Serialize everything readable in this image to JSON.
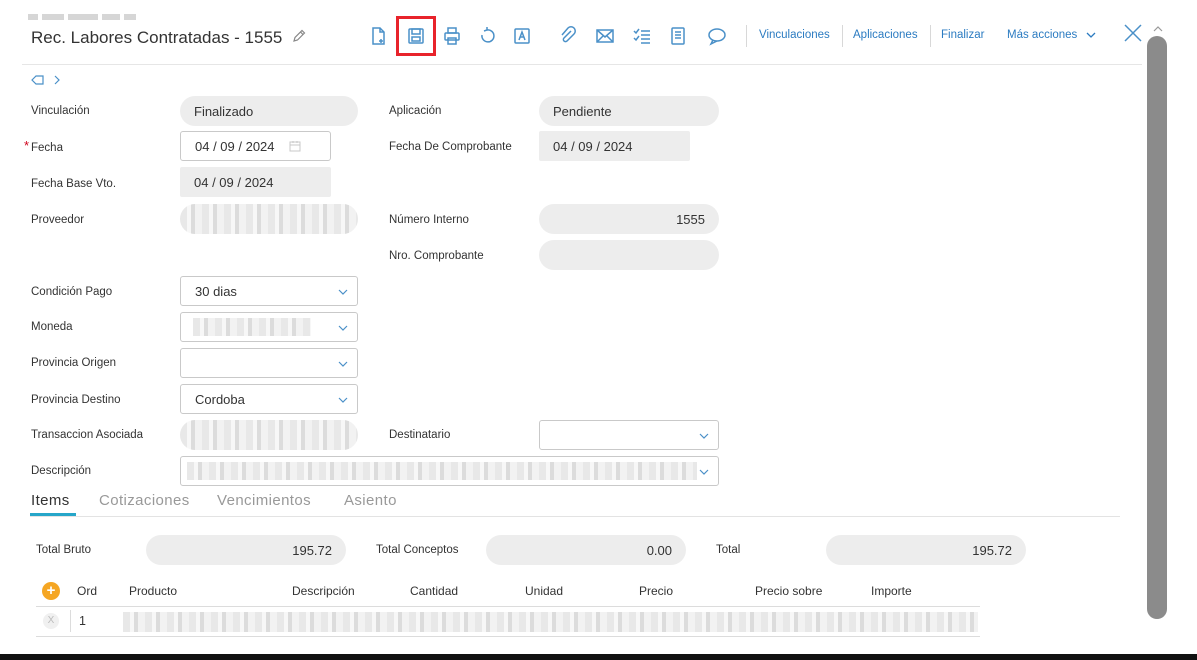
{
  "header": {
    "title": "Rec. Labores Contratadas - 1555",
    "toolbar_links": {
      "vinculaciones": "Vinculaciones",
      "aplicaciones": "Aplicaciones",
      "finalizar": "Finalizar",
      "mas_acciones": "Más acciones"
    },
    "toolbar_icons": [
      "new-document-icon",
      "save-icon",
      "print-icon",
      "undo-icon",
      "font-icon",
      "attach-icon",
      "mail-icon",
      "checklist-icon",
      "report-icon",
      "comment-icon"
    ],
    "highlight_color": "#e8232b",
    "accent_color": "#2b7bc1"
  },
  "form": {
    "vinculacion": {
      "label": "Vinculación",
      "value": "Finalizado"
    },
    "aplicacion": {
      "label": "Aplicación",
      "value": "Pendiente"
    },
    "fecha": {
      "label": "Fecha",
      "required_mark": "*",
      "value": "04 / 09 / 2024"
    },
    "fecha_comprobante": {
      "label": "Fecha De Comprobante",
      "value": "04 / 09 / 2024"
    },
    "fecha_base_vto": {
      "label": "Fecha Base Vto.",
      "value": "04 / 09 / 2024"
    },
    "proveedor": {
      "label": "Proveedor"
    },
    "numero_interno": {
      "label": "Número Interno",
      "value": "1555"
    },
    "nro_comprobante": {
      "label": "Nro. Comprobante",
      "value": ""
    },
    "condicion_pago": {
      "label": "Condición Pago",
      "value": "30 dias"
    },
    "moneda": {
      "label": "Moneda"
    },
    "provincia_origen": {
      "label": "Provincia Origen",
      "value": ""
    },
    "provincia_destino": {
      "label": "Provincia Destino",
      "value": "Cordoba"
    },
    "transaccion_asociada": {
      "label": "Transaccion Asociada"
    },
    "destinatario": {
      "label": "Destinatario",
      "value": ""
    },
    "descripcion": {
      "label": "Descripción"
    }
  },
  "tabs": [
    {
      "label": "Items",
      "active": true
    },
    {
      "label": "Cotizaciones",
      "active": false
    },
    {
      "label": "Vencimientos",
      "active": false
    },
    {
      "label": "Asiento",
      "active": false
    }
  ],
  "totals": {
    "total_bruto": {
      "label": "Total Bruto",
      "value": "195.72"
    },
    "total_conceptos": {
      "label": "Total Conceptos",
      "value": "0.00"
    },
    "total": {
      "label": "Total",
      "value": "195.72"
    }
  },
  "table": {
    "add_label": "+",
    "columns": [
      "Ord",
      "Producto",
      "Descripción",
      "Cantidad",
      "Unidad",
      "Precio",
      "Precio sobre",
      "Importe"
    ],
    "rows": [
      {
        "delete_label": "X",
        "ord": "1"
      }
    ]
  }
}
